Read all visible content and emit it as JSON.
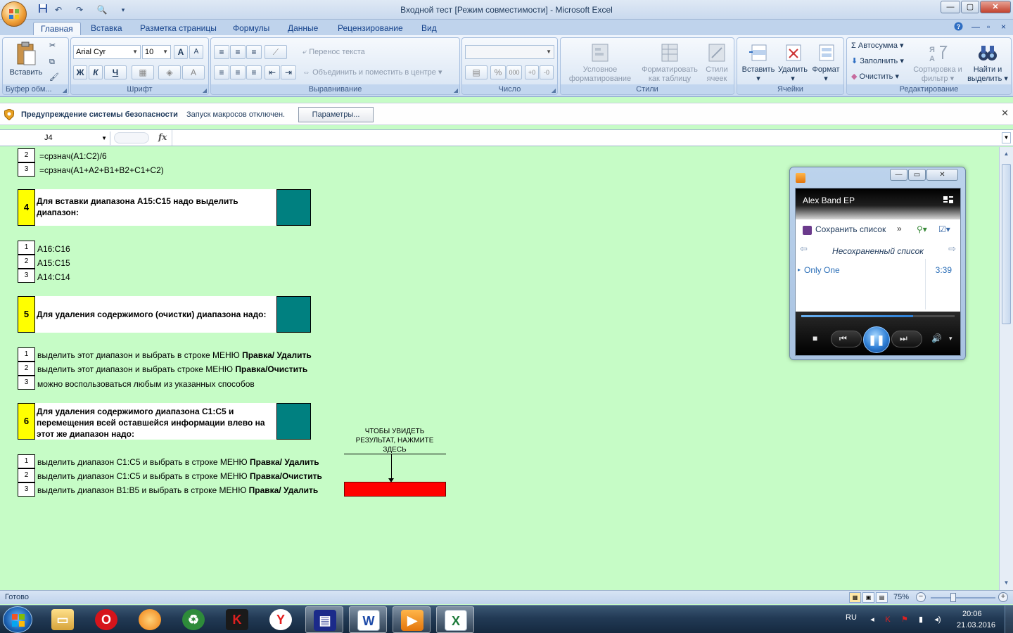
{
  "window": {
    "title": "Входной тест  [Режим совместимости] - Microsoft Excel",
    "controls": {
      "minimize": "—",
      "maximize": "▢",
      "close": "✕"
    }
  },
  "quick_access": {
    "save_icon": "save-icon",
    "undo_icon": "undo-icon",
    "redo_icon": "redo-icon",
    "preview_icon": "print-preview-icon"
  },
  "ribbon": {
    "tabs": [
      "Главная",
      "Вставка",
      "Разметка страницы",
      "Формулы",
      "Данные",
      "Рецензирование",
      "Вид"
    ],
    "active_tab": "Главная",
    "clipboard": {
      "paste": "Вставить",
      "label": "Буфер обм..."
    },
    "font": {
      "family": "Arial Cyr",
      "size": "10",
      "bold": "Ж",
      "italic": "К",
      "underline": "Ч",
      "grow": "A",
      "shrink": "A",
      "color_a": "A",
      "label": "Шрифт"
    },
    "alignment": {
      "wrap": "Перенос текста",
      "merge": "Объединить и поместить в центре",
      "label": "Выравнивание"
    },
    "number": {
      "format": "",
      "percent": "%",
      "thousands": "000",
      "label": "Число"
    },
    "styles": {
      "conditional": "Условное форматирование",
      "as_table": "Форматировать как таблицу",
      "cell_styles": "Стили ячеек",
      "label": "Стили"
    },
    "cells": {
      "insert": "Вставить",
      "delete": "Удалить",
      "format": "Формат",
      "label": "Ячейки"
    },
    "editing": {
      "autosum": "Автосумма",
      "fill": "Заполнить",
      "clear": "Очистить",
      "sort": "Сортировка и фильтр",
      "find": "Найти и выделить",
      "label": "Редактирование"
    }
  },
  "security_bar": {
    "title": "Предупреждение системы безопасности",
    "message": "Запуск макросов отключен.",
    "button": "Параметры..."
  },
  "formula_bar": {
    "name_box": "J4",
    "fx": "fx",
    "formula": ""
  },
  "sheet": {
    "top_answers": [
      {
        "n": "2",
        "text": "=срзнач(A1:C2)/6"
      },
      {
        "n": "3",
        "text": "=срзнач(A1+A2+B1+B2+C1+C2)"
      }
    ],
    "q4": {
      "n": "4",
      "text": "Для вставки диапазона A15:C15  надо выделить диапазон:",
      "answers": [
        {
          "n": "1",
          "text": "A16:C16"
        },
        {
          "n": "2",
          "text": "A15:C15"
        },
        {
          "n": "3",
          "text": "A14:C14"
        }
      ]
    },
    "q5": {
      "n": "5",
      "text": "Для удаления содержимого (очистки)  диапазона   надо:",
      "answers": [
        {
          "n": "1",
          "text": "выделить этот диапазон и выбрать в строке МЕНЮ ",
          "bold": "Правка/ Удалить"
        },
        {
          "n": "2",
          "text": "выделить этот диапазон и выбрать строке МЕНЮ ",
          "bold": "Правка/Очистить"
        },
        {
          "n": "3",
          "text": "можно воспользоваться любым из указанных способов",
          "bold": ""
        }
      ]
    },
    "q6": {
      "n": "6",
      "text": "Для удаления содержимого диапазона  С1:С5 и перемещения всей оставшейся информации влево  на этот же диапазон надо:",
      "answers": [
        {
          "n": "1",
          "text": "выделить диапазон С1:С5 и выбрать в строке МЕНЮ ",
          "bold": "Правка/ Удалить"
        },
        {
          "n": "2",
          "text": "выделить диапазон С1:С5 и выбрать в строке МЕНЮ ",
          "bold": "Правка/Очистить"
        },
        {
          "n": "3",
          "text": "выделить диапазон В1:В5 и выбрать в строке МЕНЮ ",
          "bold": "Правка/ Удалить"
        }
      ]
    },
    "result_hint": "ЧТОБЫ УВИДЕТЬ РЕЗУЛЬТАТ, НАЖМИТЕ ЗДЕСЬ",
    "colors": {
      "background": "#c6fcc6",
      "question_number": "#ffff00",
      "teal_box": "#008080",
      "result_button": "#ff0000"
    }
  },
  "status_bar": {
    "status": "Готово",
    "zoom": "75%",
    "zoom_minus": "−",
    "zoom_plus": "+"
  },
  "media_player": {
    "album": "Alex Band EP",
    "save_list": "Сохранить список",
    "more": "»",
    "list_name": "Несохраненный список",
    "track": {
      "title": "Only One",
      "duration": "3:39"
    },
    "progress": 0.73,
    "controls": {
      "stop": "■",
      "prev": "⏮",
      "play_pause": "❚❚",
      "next": "⏭",
      "volume": "🔊"
    }
  },
  "taskbar": {
    "apps": [
      "explorer-icon",
      "opera-icon",
      "browser-icon",
      "winrar-icon",
      "kaspersky-icon",
      "yandex-icon",
      "save-app-icon",
      "word-icon",
      "media-player-icon",
      "excel-icon"
    ],
    "app_glyphs": {
      "opera": "O",
      "kaspersky": "K",
      "yandex": "Y",
      "word": "W",
      "excel": "X"
    },
    "language": "RU",
    "time": "20:06",
    "date": "21.03.2016"
  }
}
